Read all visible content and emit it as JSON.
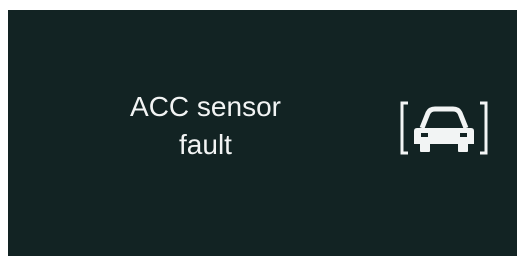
{
  "alert": {
    "message": "ACC sensor\nfault",
    "icon": "car-sensor-bracket-icon"
  },
  "colors": {
    "background": "#122323",
    "foreground": "#f2f4f4",
    "frame": "#ffffff"
  }
}
